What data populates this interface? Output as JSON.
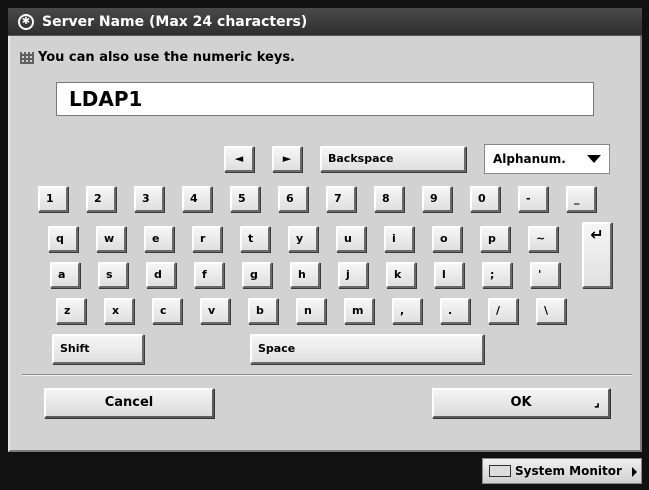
{
  "title": "Server Name (Max 24 characters)",
  "title_icon": "settings-icon",
  "hint": "You can also use the numeric keys.",
  "input_value": "LDAP1",
  "nav": {
    "left": "◄",
    "right": "►",
    "backspace": "Backspace"
  },
  "mode_select": "Alphanum.",
  "rows": {
    "r1": [
      "1",
      "2",
      "3",
      "4",
      "5",
      "6",
      "7",
      "8",
      "9",
      "0",
      "-",
      "_"
    ],
    "r2": [
      "q",
      "w",
      "e",
      "r",
      "t",
      "y",
      "u",
      "i",
      "o",
      "p",
      "~"
    ],
    "r3": [
      "a",
      "s",
      "d",
      "f",
      "g",
      "h",
      "j",
      "k",
      "l",
      ";",
      "'"
    ],
    "r4": [
      "z",
      "x",
      "c",
      "v",
      "b",
      "n",
      "m",
      ",",
      ".",
      "/",
      "\\"
    ]
  },
  "enter_symbol": "↵",
  "shift": "Shift",
  "space": "Space",
  "cancel": "Cancel",
  "ok": "OK",
  "ok_icon": "⌟",
  "system_monitor": "System Monitor"
}
